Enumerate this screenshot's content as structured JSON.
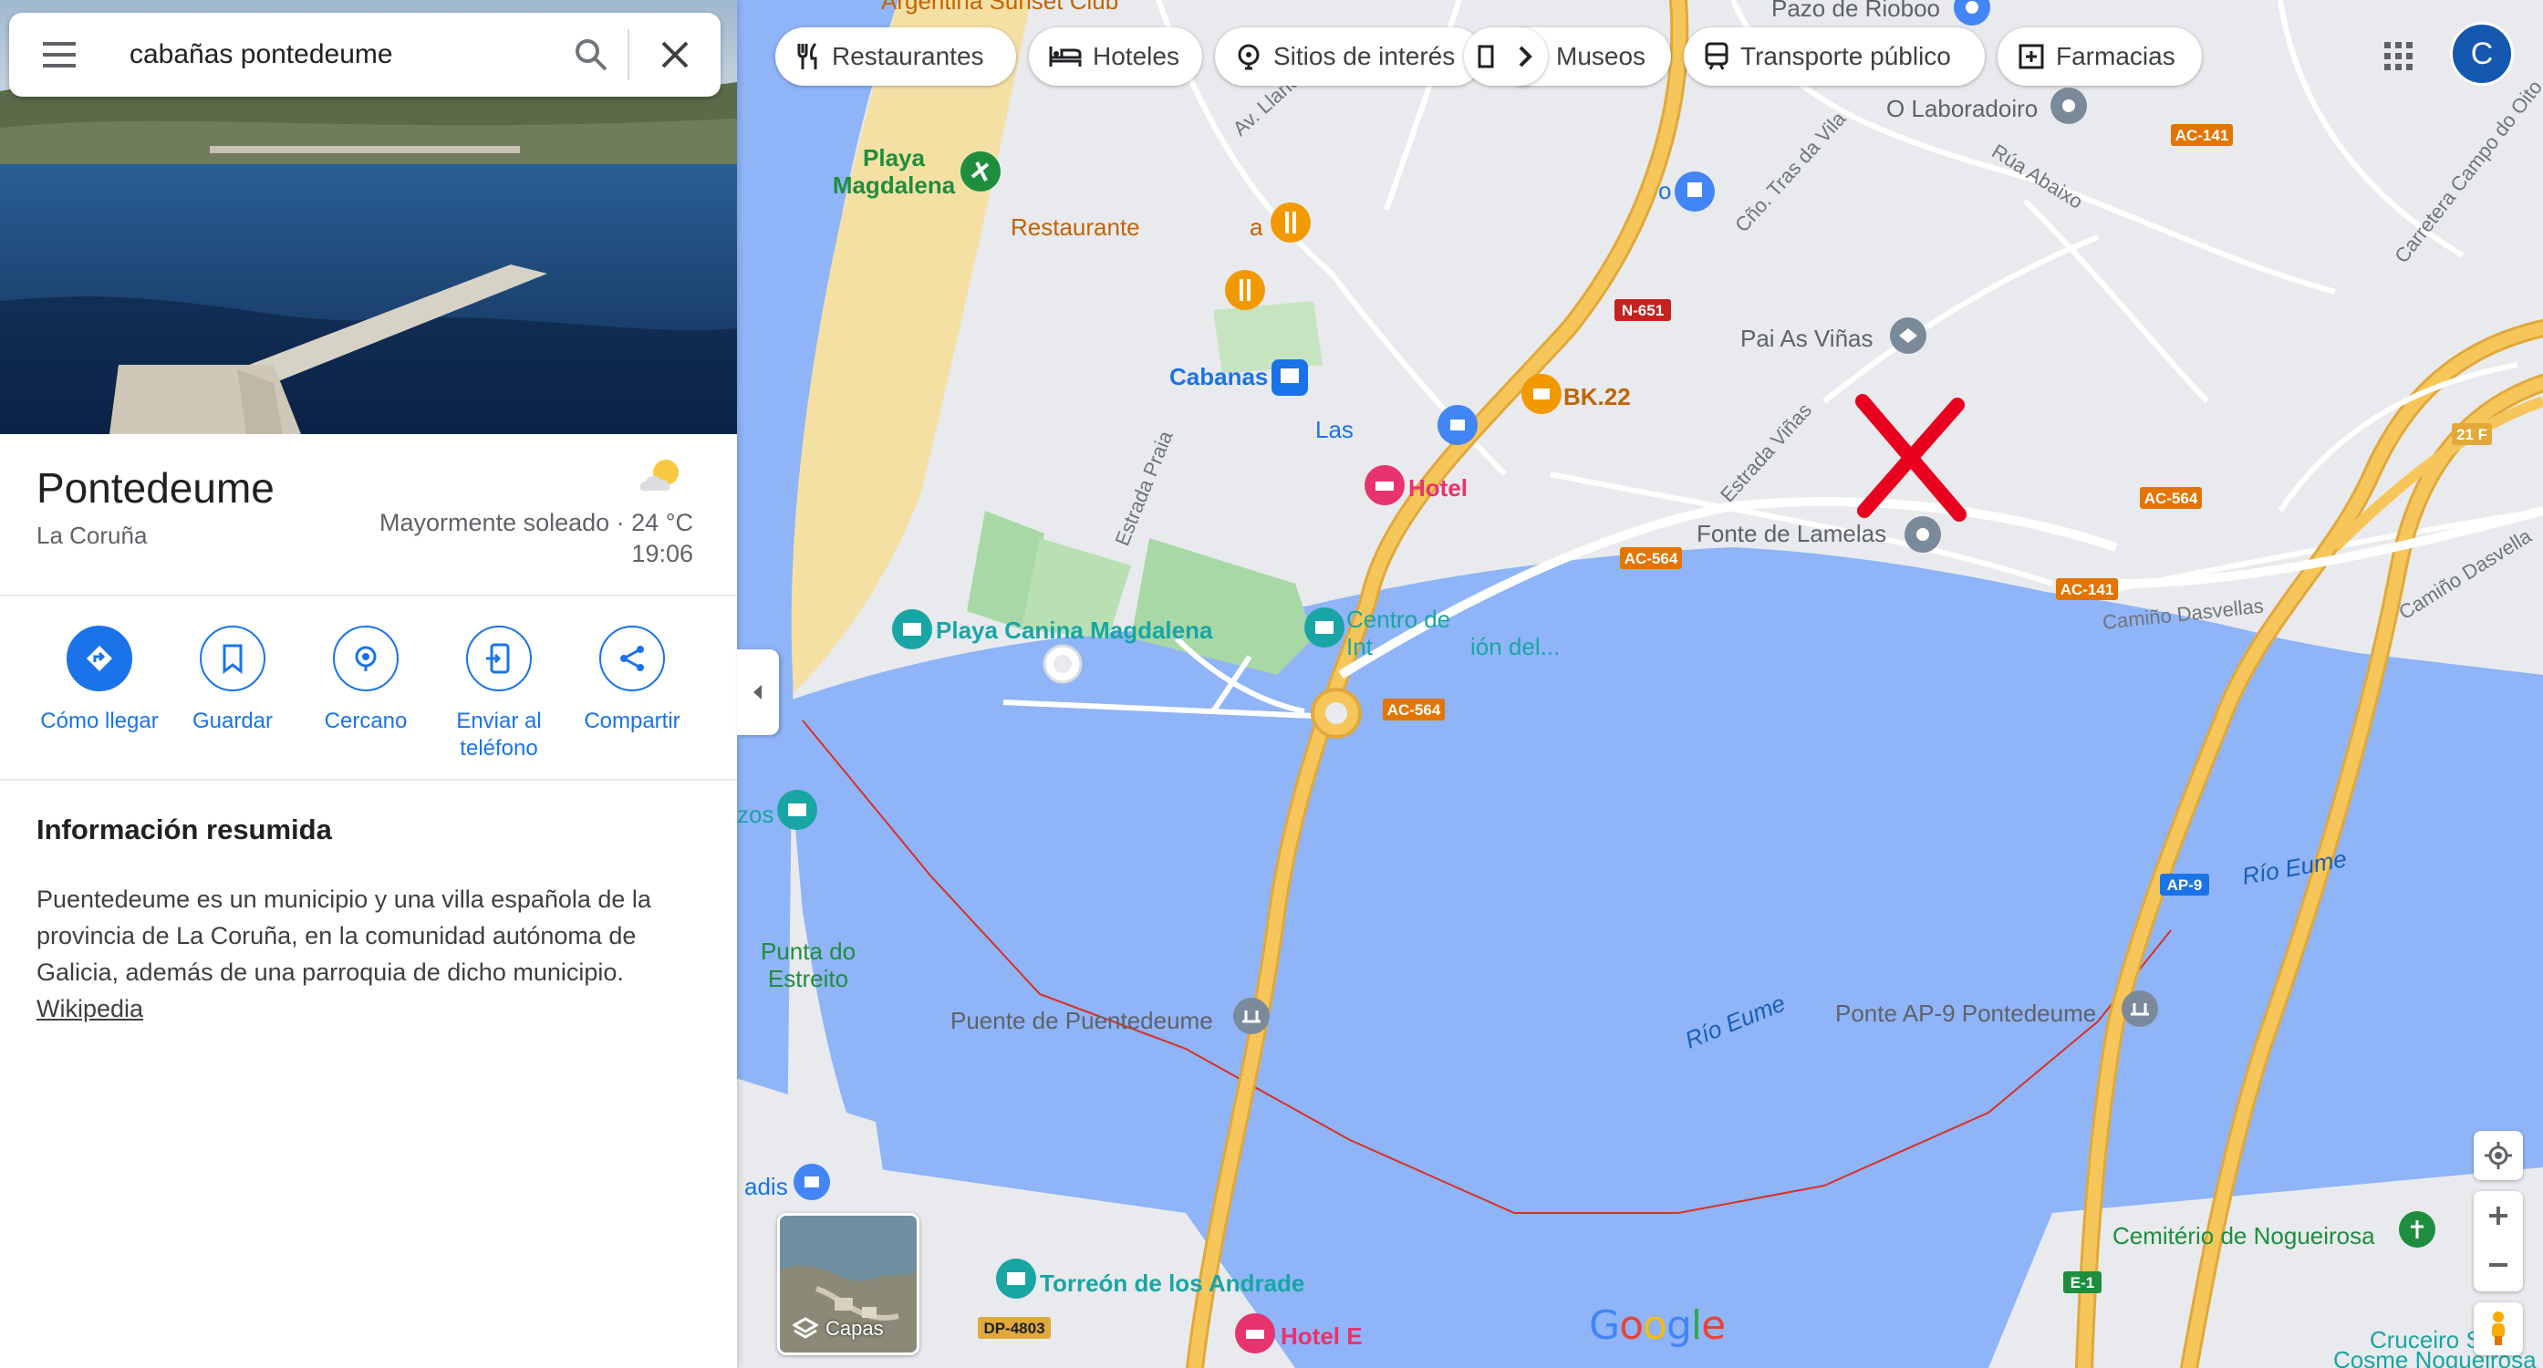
{
  "search": {
    "value": "cabañas pontedeume"
  },
  "place": {
    "title": "Pontedeume",
    "subtitle": "La Coruña",
    "weather_text": "Mayormente soleado · 24 °C",
    "weather_time": "19:06"
  },
  "actions": [
    {
      "label": "Cómo llegar",
      "icon": "directions-icon"
    },
    {
      "label": "Guardar",
      "icon": "bookmark-icon"
    },
    {
      "label": "Cercano",
      "icon": "nearby-icon"
    },
    {
      "label": "Enviar al teléfono",
      "icon": "send-to-phone-icon"
    },
    {
      "label": "Compartir",
      "icon": "share-icon"
    }
  ],
  "info": {
    "title": "Información resumida",
    "text": "Puentedeume  es un municipio y una villa española de la provincia de La Coruña, en la comunidad autónoma de Galicia, además de una parroquia de dicho municipio.",
    "link": "Wikipedia"
  },
  "chips": [
    {
      "label": "Restaurantes",
      "icon": "restaurant-icon"
    },
    {
      "label": "Hoteles",
      "icon": "hotel-icon"
    },
    {
      "label": "Sitios de interés",
      "icon": "attraction-icon"
    },
    {
      "label": "Museos",
      "icon": "museum-icon"
    },
    {
      "label": "Transporte público",
      "icon": "transit-icon"
    },
    {
      "label": "Farmacias",
      "icon": "pharmacy-icon"
    }
  ],
  "avatar_letter": "C",
  "layers_label": "Capas",
  "google_logo": "Google",
  "map_labels": {
    "playa_magdalena": [
      "Playa",
      "Magdalena"
    ],
    "restaurante": "Restaurante",
    "cabanas": "Cabanas",
    "las": "Las",
    "hotel": "Hotel",
    "bk22": "BK.22",
    "pai_as_vinas": "Pai As Viñas",
    "o_laboradoiro": "O Laboradoiro",
    "pazo_de_rioboo": "Pazo de Rioboo",
    "argentina_sunset": "Argentina Sunset Club",
    "fonte_de_lamelas": "Fonte de Lamelas",
    "playa_canina": "Playa Canina Magdalena",
    "centro_de": "Centro de",
    "int": "Int",
    "ion_del": "ión del...",
    "punta_do_estreito": [
      "Punta do",
      "Estreito"
    ],
    "puente_de_puentedeume": "Puente de Puentedeume",
    "ponte_ap9": "Ponte AP-9 Pontedeume",
    "rio_eume_1": "Río Eume",
    "rio_eume_2": "Río Eume",
    "cemiterio": "Cemitério de Nogueirosa",
    "torreon": "Torreón de los Andrade",
    "hotel_e": "Hotel E",
    "cruceiro": "Cruceiro S",
    "cosme": "Cosme Nogueirosa",
    "zos": "zos",
    "adis": "adis",
    "av_llano": "Av. Llano",
    "cno_tras_da_vila": "Cño. Tras da Vila",
    "rua_abaixo": "Rúa Abaixo",
    "carretera_campo": "Carretera Campo do Oito",
    "estrada_vinas": "Estrada Viñas",
    "estrada_praia": "Estrada Praia",
    "camino_dasvellas": "Camiño Dasvellas",
    "camino_dasvella_2": "Camiño Dasvella",
    "a": "a",
    "o": "o"
  },
  "road_shields": {
    "n651": "N-651",
    "ac141_a": "AC-141",
    "ac141_b": "AC-141",
    "ac564_a": "AC-564",
    "ac564_b": "AC-564",
    "ac564_c": "AC-564",
    "ap9": "AP-9",
    "f21": "21 F",
    "e1": "E-1",
    "dp4803": "DP-4803"
  },
  "colors": {
    "water": "#8fb4f7",
    "land": "#e8eaed",
    "road": "#f7c65a",
    "road_edge": "#e0a93a",
    "park": "#a8d8a6",
    "beach": "#f5e0a4",
    "accent": "#1a73e8",
    "marker_red": "#e8001e"
  }
}
